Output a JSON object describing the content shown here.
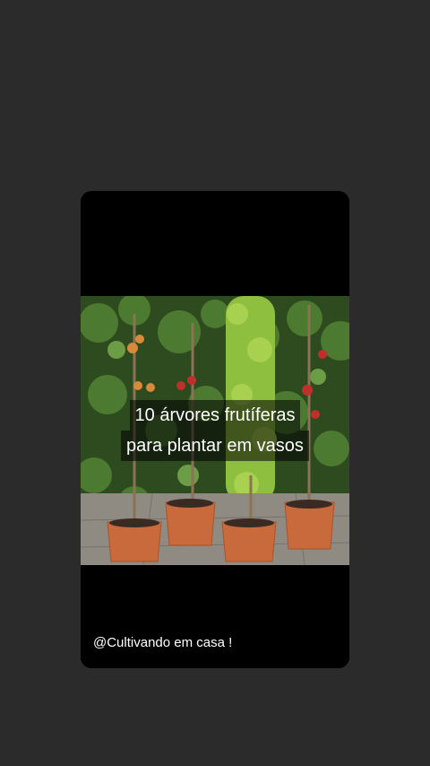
{
  "post": {
    "caption_line1": "10 árvores frutíferas",
    "caption_line2": "para plantar em vasos",
    "handle": "@Cultivando em casa !"
  },
  "colors": {
    "background": "#2c2b2b",
    "card": "#000000",
    "caption_text": "#ffffff",
    "pot": "#c96a3c"
  }
}
